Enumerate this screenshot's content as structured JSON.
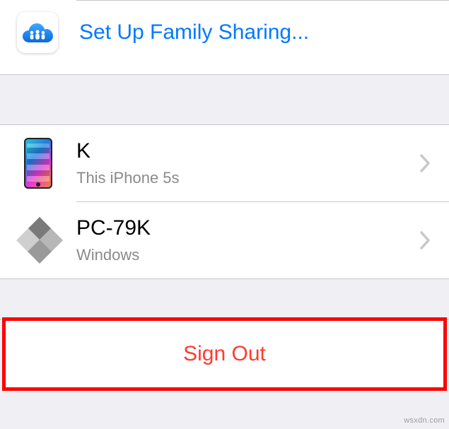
{
  "family_sharing": {
    "label": "Set Up Family Sharing..."
  },
  "devices": [
    {
      "title": "K",
      "subtitle": "This iPhone 5s"
    },
    {
      "title": "PC-79K",
      "subtitle": "Windows"
    }
  ],
  "sign_out": {
    "label": "Sign Out"
  },
  "watermark": "wsxdn.com",
  "colors": {
    "link": "#0079ff",
    "destructive": "#ff3b30",
    "highlight": "#ff0000",
    "separator": "#c8c7cc",
    "grouped_bg": "#efeff4",
    "secondary_text": "#8a8a8e"
  }
}
